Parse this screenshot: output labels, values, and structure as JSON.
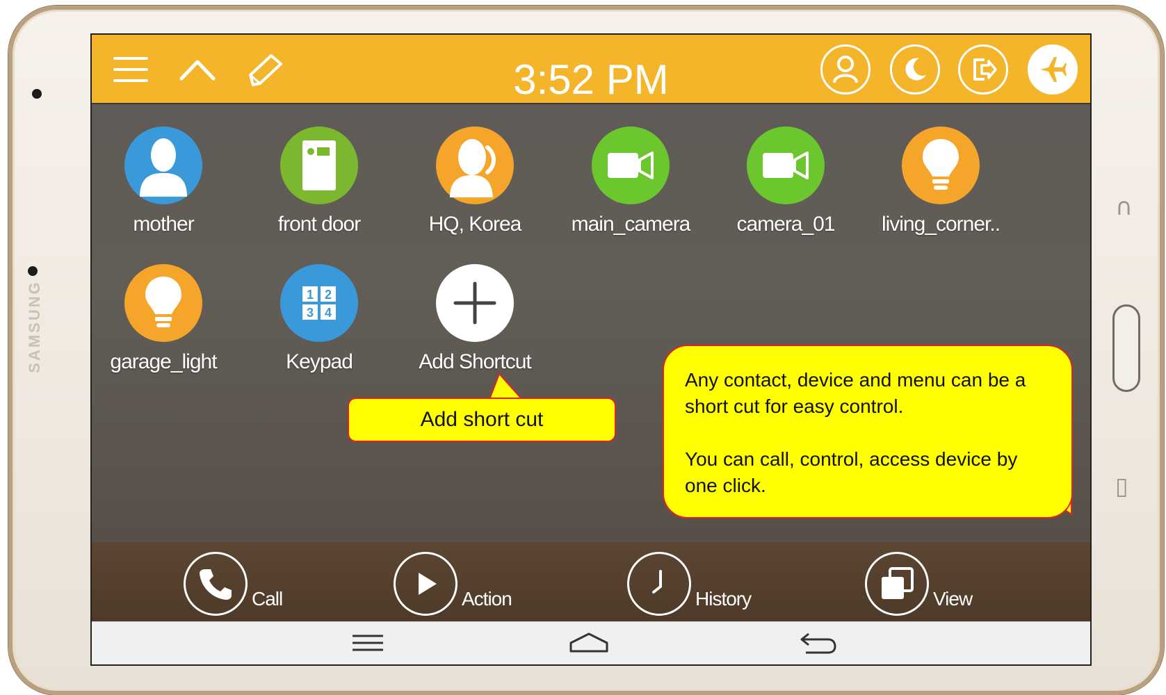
{
  "device": {
    "brand": "SAMSUNG"
  },
  "statusbar": {
    "time": "3:52 PM",
    "left_icons": [
      "menu-icon",
      "chevron-up-icon",
      "edit-icon"
    ],
    "right_icons": [
      "profile-icon",
      "moon-icon",
      "exit-icon",
      "airplane-icon"
    ],
    "color": "#f4b52a"
  },
  "shortcuts": [
    {
      "label": "mother",
      "icon": "person-icon",
      "color": "#3a9ad9"
    },
    {
      "label": "front door",
      "icon": "door-icon",
      "color": "#7cb82f"
    },
    {
      "label": "HQ, Korea",
      "icon": "phone-person-icon",
      "color": "#f4a52a"
    },
    {
      "label": "main_camera",
      "icon": "camera-icon",
      "color": "#6cc62d"
    },
    {
      "label": "camera_01",
      "icon": "camera-icon",
      "color": "#6cc62d"
    },
    {
      "label": "living_corner..",
      "icon": "bulb-icon",
      "color": "#f4a52a"
    },
    {
      "label": "garage_light",
      "icon": "bulb-icon",
      "color": "#f4a52a"
    },
    {
      "label": "Keypad",
      "icon": "keypad-icon",
      "color": "#3a9ad9",
      "keys": [
        "1",
        "2",
        "3",
        "4"
      ]
    },
    {
      "label": "Add Shortcut",
      "icon": "plus-icon",
      "color": "#ffffff"
    }
  ],
  "bottom_bar": [
    {
      "label": "Call",
      "icon": "phone-icon"
    },
    {
      "label": "Action",
      "icon": "play-icon"
    },
    {
      "label": "History",
      "icon": "clock-icon"
    },
    {
      "label": "View",
      "icon": "view-icon"
    }
  ],
  "navbar": {
    "icons": [
      "recent-apps-icon",
      "home-icon",
      "back-icon"
    ]
  },
  "callouts": {
    "add": "Add short cut",
    "info_line1": "Any contact, device and menu can be a short cut for easy control.",
    "info_line2": "You can call, control, access device by one click.",
    "fill": "#ffff00",
    "border": "#e0232b"
  }
}
